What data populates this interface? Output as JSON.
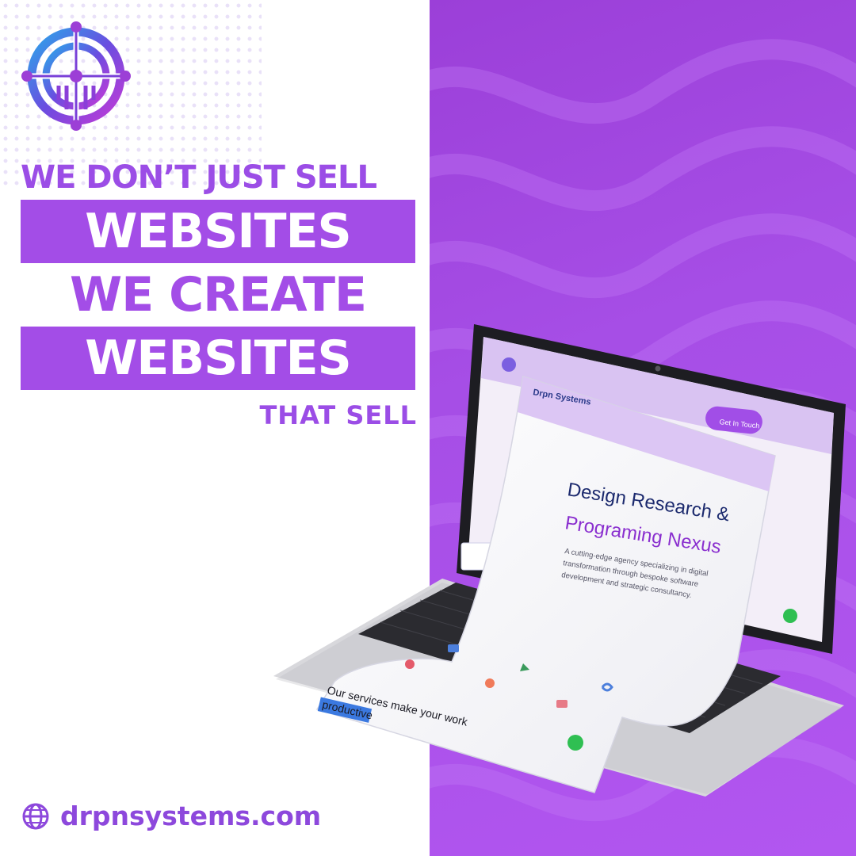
{
  "headline": {
    "line1": "WE DON’T JUST SELL",
    "line2": "WEBSITES",
    "line3": "WE CREATE",
    "line4": "WEBSITES",
    "line5": "THAT SELL"
  },
  "footer": {
    "website": "drpnsystems.com",
    "icon": "globe-icon"
  },
  "screen": {
    "brand": "Drpn Systems",
    "cta_button": "Get In Touch",
    "hero_title_line1": "Design Research &",
    "hero_title_line2": "Programing Nexus",
    "hero_paragraph_line1": "A cutting-edge agency specializing in digital",
    "hero_paragraph_line2": "transformation through bespoke software",
    "hero_paragraph_line3": "development and strategic consultancy.",
    "services_text": "Our services make your work",
    "highlight_text": "productive"
  },
  "colors": {
    "accent": "#a34de7",
    "dark_navy": "#1c2a6e",
    "background": "#ffffff"
  }
}
